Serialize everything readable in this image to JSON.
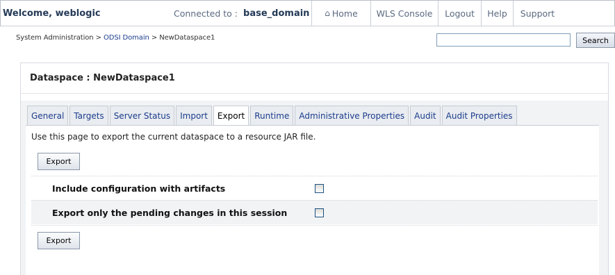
{
  "header": {
    "welcome": "Welcome, weblogic",
    "connected_label": "Connected to :",
    "domain": "base_domain",
    "nav": [
      {
        "label": "Home",
        "icon": "home-icon"
      },
      {
        "label": "WLS Console"
      },
      {
        "label": "Logout"
      },
      {
        "label": "Help"
      },
      {
        "label": "Support"
      }
    ]
  },
  "breadcrumb": {
    "item1": "System Administration",
    "sep": " > ",
    "item2": "ODSI Domain",
    "item3": "NewDataspace1"
  },
  "search": {
    "value": "",
    "button": "Search"
  },
  "panel": {
    "title": "Dataspace : NewDataspace1",
    "tabs": [
      "General",
      "Targets",
      "Server Status",
      "Import",
      "Export",
      "Runtime",
      "Administrative Properties",
      "Audit",
      "Audit Properties"
    ],
    "active_tab": "Export",
    "description": "Use this page to export the current dataspace to a resource JAR file.",
    "export_button_top": "Export",
    "options": [
      {
        "label": "Include configuration with artifacts",
        "checked": false
      },
      {
        "label": "Export only the pending changes in this session",
        "checked": false
      }
    ],
    "export_button_bottom": "Export"
  }
}
